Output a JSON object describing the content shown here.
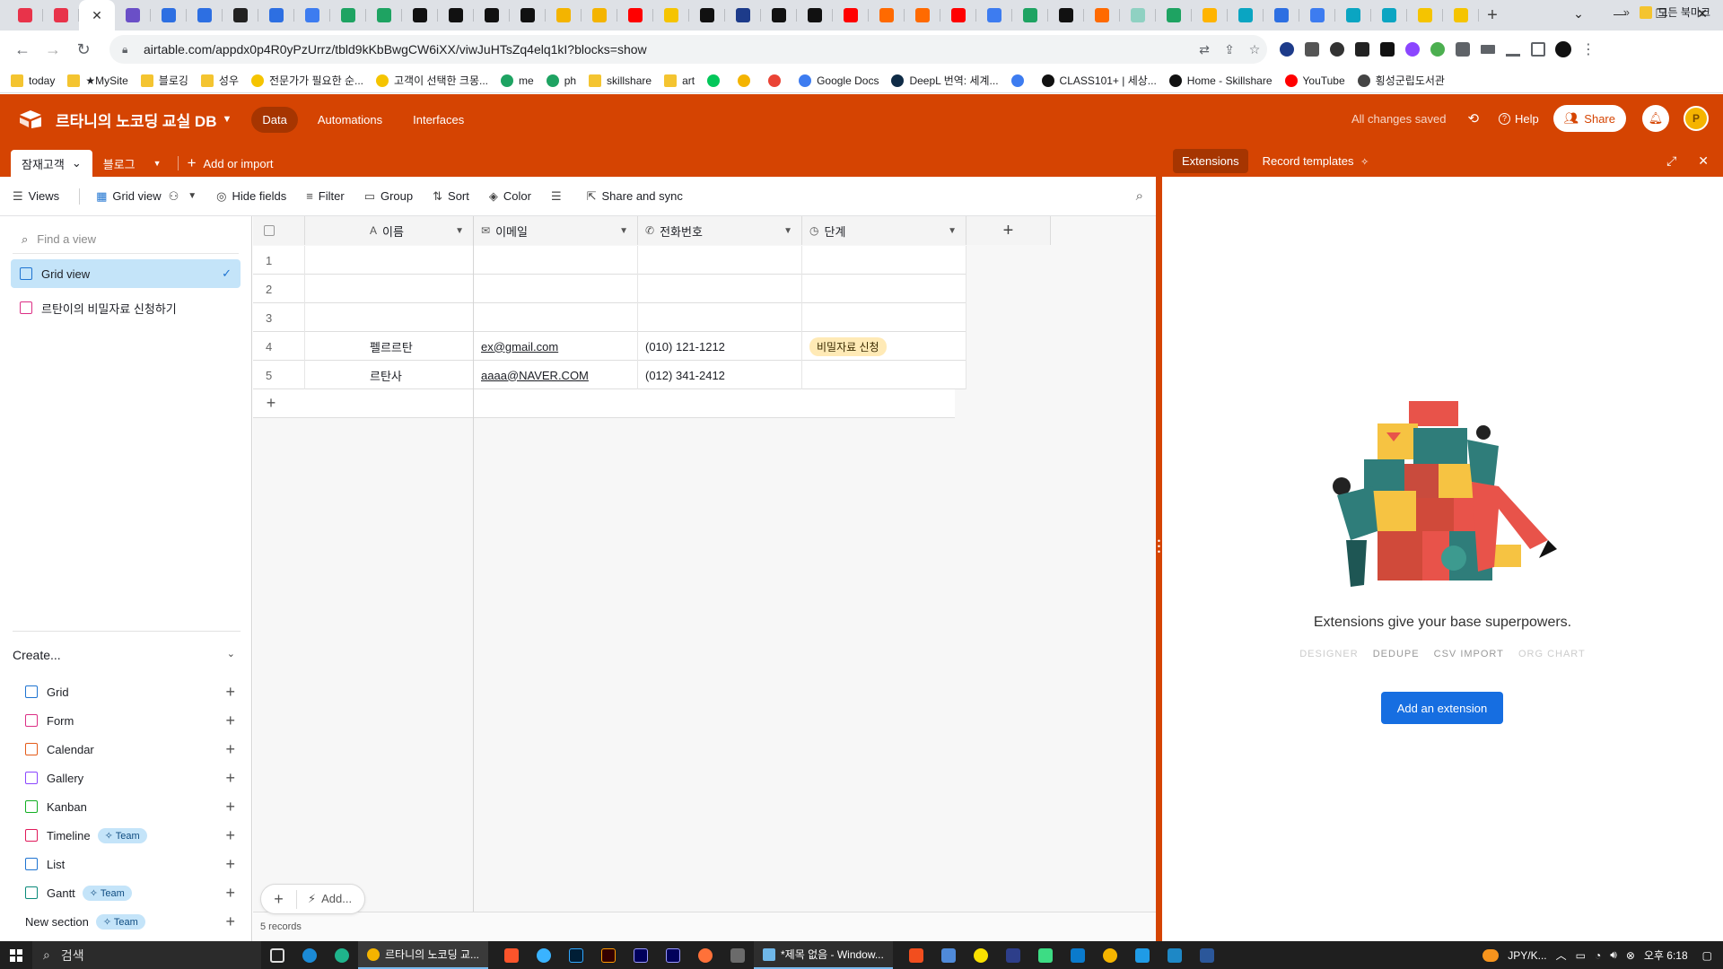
{
  "browser": {
    "tab_favicon_colors": [
      "#e8334a",
      "#e8334a",
      "#ffffff",
      "#6a4fc7",
      "#2d6fe2",
      "#2d6fe2",
      "#222222",
      "#2d6fe2",
      "#3d7cf0",
      "#1ea362",
      "#1ea362",
      "#111111",
      "#111111",
      "#111111",
      "#111111",
      "#f4b400",
      "#f4b400",
      "#ff0000",
      "#f5c400",
      "#111111",
      "#1d3b8a",
      "#111111",
      "#111111",
      "#ff0000",
      "#ff6a00",
      "#ff6a00",
      "#ff0000",
      "#3d7cf0",
      "#1ea362",
      "#111111",
      "#ff6a00",
      "#8fd1c2",
      "#1ea362",
      "#ffb400",
      "#0aa5c2",
      "#2d6fe2",
      "#3d7cf0",
      "#0aa5c2",
      "#0aa5c2",
      "#f5c400",
      "#f5c400"
    ],
    "active_tab_index": 2,
    "url": "airtable.com/appdx0p4R0yPzUrrz/tbld9kKbBwgCW6iXX/viwJuHTsZq4elq1kI?blocks=show"
  },
  "bookmarks": {
    "items": [
      {
        "label": "today",
        "icon": "folder-icon",
        "color": "#f4c430"
      },
      {
        "label": "★MySite",
        "icon": "folder-icon",
        "color": "#f4c430"
      },
      {
        "label": "블로깅",
        "icon": "folder-icon",
        "color": "#f4c430"
      },
      {
        "label": "성우",
        "icon": "folder-icon",
        "color": "#f4c430"
      },
      {
        "label": "전문가가 필요한 순...",
        "icon": "smile-icon",
        "color": "#f5c400"
      },
      {
        "label": "고객이 선택한 크몽...",
        "icon": "smile-icon",
        "color": "#f5c400"
      },
      {
        "label": "me",
        "icon": "sheet-icon",
        "color": "#1ea362"
      },
      {
        "label": "ph",
        "icon": "sheet-icon",
        "color": "#1ea362"
      },
      {
        "label": "skillshare",
        "icon": "folder-icon",
        "color": "#f4c430"
      },
      {
        "label": "art",
        "icon": "folder-icon",
        "color": "#f4c430"
      },
      {
        "label": "",
        "icon": "n-icon",
        "color": "#03c75a"
      },
      {
        "label": "",
        "icon": "drive-icon",
        "color": "#f4b400"
      },
      {
        "label": "",
        "icon": "gmail-icon",
        "color": "#ea4335"
      },
      {
        "label": "Google Docs",
        "icon": "docs-icon",
        "color": "#3d7cf0"
      },
      {
        "label": "DeepL 번역: 세계...",
        "icon": "deepl-icon",
        "color": "#0f2b46"
      },
      {
        "label": "",
        "icon": "translate-icon",
        "color": "#3d7cf0"
      },
      {
        "label": "CLASS101+ | 세상...",
        "icon": "class101-icon",
        "color": "#111111"
      },
      {
        "label": "Home - Skillshare",
        "icon": "skillshare-icon",
        "color": "#111111"
      },
      {
        "label": "YouTube",
        "icon": "youtube-icon",
        "color": "#ff0000"
      },
      {
        "label": "횡성군립도서관",
        "icon": "globe-icon",
        "color": "#444444"
      }
    ],
    "more": "»",
    "all_bookmarks": "모든 북마크"
  },
  "app": {
    "base_name": "르타니의 노코딩 교실 DB",
    "nav": [
      {
        "label": "Data",
        "active": true
      },
      {
        "label": "Automations",
        "active": false
      },
      {
        "label": "Interfaces",
        "active": false
      }
    ],
    "saved_status": "All changes saved",
    "help": "Help",
    "share": "Share",
    "avatar_initial": "P",
    "brand_color": "#d54402"
  },
  "tables": {
    "items": [
      {
        "label": "잠재고객",
        "active": true
      },
      {
        "label": "블로그",
        "active": false
      }
    ],
    "add_or_import": "Add or import"
  },
  "toolbar": {
    "views": "Views",
    "grid_view": "Grid view",
    "hide_fields": "Hide fields",
    "filter": "Filter",
    "group": "Group",
    "sort": "Sort",
    "color": "Color",
    "share_sync": "Share and sync"
  },
  "sidebar": {
    "find_placeholder": "Find a view",
    "views": [
      {
        "label": "Grid view",
        "active": true,
        "icon": "grid-icon"
      },
      {
        "label": "르탄이의 비밀자료 신청하기",
        "active": false,
        "icon": "form-icon"
      }
    ],
    "create_label": "Create...",
    "create_items": [
      {
        "label": "Grid",
        "icon": "grid-icon",
        "color": "#1f74d1",
        "badge": ""
      },
      {
        "label": "Form",
        "icon": "form-icon",
        "color": "#dc2f85",
        "badge": ""
      },
      {
        "label": "Calendar",
        "icon": "calendar-icon",
        "color": "#e45b19",
        "badge": ""
      },
      {
        "label": "Gallery",
        "icon": "gallery-icon",
        "color": "#8b46ff",
        "badge": ""
      },
      {
        "label": "Kanban",
        "icon": "kanban-icon",
        "color": "#11af22",
        "badge": ""
      },
      {
        "label": "Timeline",
        "icon": "timeline-icon",
        "color": "#e0195a",
        "badge": "Team"
      },
      {
        "label": "List",
        "icon": "list-icon",
        "color": "#1f74d1",
        "badge": ""
      },
      {
        "label": "Gantt",
        "icon": "gantt-icon",
        "color": "#0b8a7a",
        "badge": "Team"
      },
      {
        "label": "New section",
        "icon": "",
        "color": "",
        "badge": "Team"
      }
    ]
  },
  "grid": {
    "columns": [
      {
        "label": "이름",
        "icon": "text-icon"
      },
      {
        "label": "이메일",
        "icon": "email-icon"
      },
      {
        "label": "전화번호",
        "icon": "phone-icon"
      },
      {
        "label": "단계",
        "icon": "status-icon"
      }
    ],
    "rows": [
      {
        "num": "1",
        "name": "",
        "email": "",
        "phone": "",
        "stage": ""
      },
      {
        "num": "2",
        "name": "",
        "email": "",
        "phone": "",
        "stage": ""
      },
      {
        "num": "3",
        "name": "",
        "email": "",
        "phone": "",
        "stage": ""
      },
      {
        "num": "4",
        "name": "펠르르탄",
        "email": "ex@gmail.com",
        "phone": "(010) 121-1212",
        "stage": "비밀자료 신청"
      },
      {
        "num": "5",
        "name": "르탄사",
        "email": "aaaa@NAVER.COM",
        "phone": "(012) 341-2412",
        "stage": ""
      }
    ],
    "add_label": "Add...",
    "record_count": "5 records"
  },
  "extensions": {
    "tabs": [
      {
        "label": "Extensions",
        "active": true
      },
      {
        "label": "Record templates",
        "active": false
      }
    ],
    "message": "Extensions give your base superpowers.",
    "examples": [
      "DESIGNER",
      "DEDUPE",
      "CSV IMPORT",
      "ORG CHART"
    ],
    "button": "Add an extension"
  },
  "taskbar": {
    "search": "검색",
    "active_window": "르타니의 노코딩 교...",
    "notepad_window": "*제목 없음 - Window...",
    "tray_lang": "JPY/K...",
    "time": "오후 6:18"
  }
}
